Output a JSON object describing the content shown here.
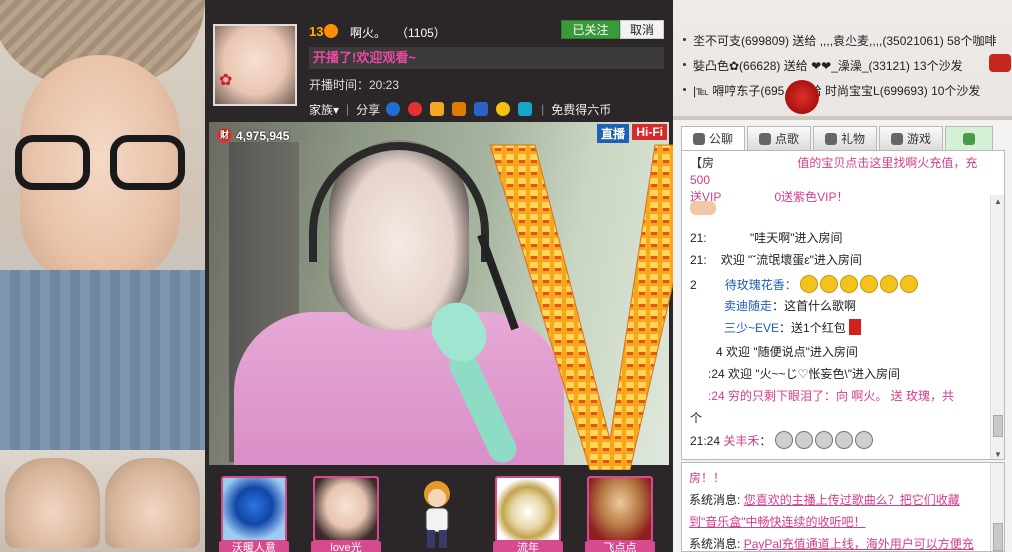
{
  "anchor": {
    "level": "13",
    "name": "啊火。",
    "id": "（1105）",
    "followed_label": "已关注",
    "cancel_label": "取消",
    "announcement": "开播了!欢迎观看~",
    "airtime": "开播时间：20:23",
    "family_label": "家族▾",
    "share_label": "分享",
    "free_coins_label": "免费得六币"
  },
  "video": {
    "wealth": "4,975,945",
    "wealth_icon": "财",
    "live_badge": "直播",
    "hifi_badge": "Hi-Fi"
  },
  "gifts": [
    {
      "label": "沃暖人意"
    },
    {
      "label": "love光"
    },
    {
      "label": ""
    },
    {
      "label": "流年"
    },
    {
      "label": "飞点点"
    }
  ],
  "ticker": [
    "坔不可支(699809) 送给 ,,,,袁尐麦,,,,(35021061) 58个咖啡",
    "娤凸色✿(66628) 送给 ❤❤_澡澡_(33121) 13个沙发",
    "|℡ 嘚哼东子(695... 送给 时尚宝宝L(699693) 10个沙发"
  ],
  "tabs": [
    {
      "label": "公聊",
      "icon": "chat-bubble-icon"
    },
    {
      "label": "点歌",
      "icon": "microphone-icon"
    },
    {
      "label": "礼物",
      "icon": "gift-icon"
    },
    {
      "label": "游戏",
      "icon": "gamepad-icon"
    },
    {
      "label": "",
      "icon": "badge-icon"
    }
  ],
  "chat": {
    "notice_prefix": "【房",
    "notice_text": "值的宝贝点击这里找啊火充值，充500",
    "notice_line2_a": "送VIP",
    "notice_line2_b": "0送紫色VIP！",
    "lines": [
      {
        "time": "21:",
        "text": " \"哇天啊\"进入房间"
      },
      {
        "time": "21:",
        "text": "欢迎 \"ˇ流氓壞蛋ε\"进入房间"
      },
      {
        "time": "2",
        "user": "待玫瑰花香：",
        "text": ""
      },
      {
        "time": "",
        "user": "卖迪随走",
        "text": "：这首什么歌啊"
      },
      {
        "time": "",
        "user": "三少~EVE",
        "text": "：送1个红包"
      },
      {
        "time": "",
        "text": "4 欢迎 \"随便说点\"进入房间"
      },
      {
        "time": "",
        "text": ":24 欢迎 \"火~~じ♡怅妄色\\\"进入房间"
      },
      {
        "time": "",
        "text": ":24 穷的只剩下眼泪了：向 啊火。 送    玫瑰，共"
      },
      {
        "time": "",
        "text": "个"
      },
      {
        "time": "21:24",
        "user": "关丰禾",
        "text": "："
      }
    ]
  },
  "system": {
    "line0": "房！！",
    "label": "系统消息:",
    "msg1_a": "您喜欢的主播上传过歌曲么？把它们收藏",
    "msg1_b": "到\"音乐盒\"中畅快连续的收听吧！",
    "msg2": "PayPal充值通道上线，海外用户可以方便充"
  },
  "colors": {
    "accent_pink": "#d63c8a",
    "follow_green": "#3a9a3a",
    "live_blue": "#1d60b8",
    "hifi_red": "#d82a2a"
  }
}
